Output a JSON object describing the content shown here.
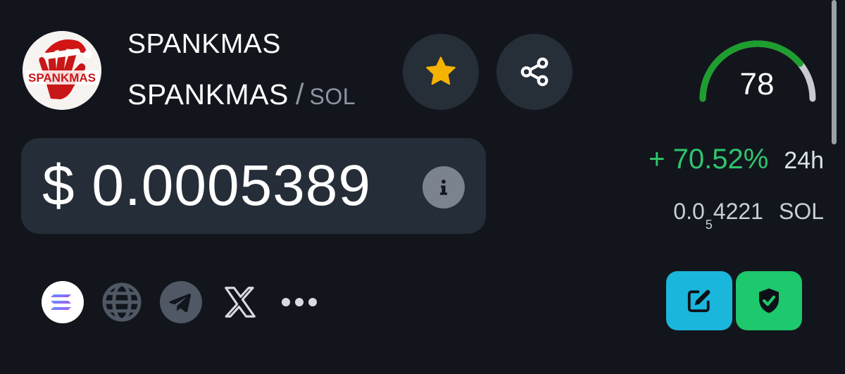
{
  "token": {
    "name": "SPANKMAS",
    "symbol": "SPANKMAS",
    "separator": "/",
    "quote": "SOL",
    "logo_text": "SPANKMAS"
  },
  "actions": {
    "favorite_icon": "star-icon",
    "share_icon": "share-icon",
    "info_icon": "info-icon"
  },
  "price": {
    "usd": "$ 0.0005389"
  },
  "score": {
    "value": "78",
    "level": 0.78,
    "colors": {
      "fill": "#1e9e2e",
      "track": "#c8ccd2"
    }
  },
  "change": {
    "percent": "+ 70.52%",
    "period": "24h",
    "color": "#2fc56e"
  },
  "native_price": {
    "prefix": "0.0",
    "zeros": "5",
    "digits": "4221",
    "unit": "SOL"
  },
  "links": [
    {
      "name": "solana-icon"
    },
    {
      "name": "website-globe-icon"
    },
    {
      "name": "telegram-icon"
    },
    {
      "name": "x-twitter-icon"
    },
    {
      "name": "more-dots-icon"
    }
  ],
  "buttons": {
    "edit": {
      "icon": "edit-icon",
      "color": "#1bb6dc"
    },
    "audit": {
      "icon": "shield-check-icon",
      "color": "#1ec86d"
    }
  },
  "colors": {
    "background": "#12161c",
    "card": "#242d38",
    "star": "#f5b301"
  }
}
